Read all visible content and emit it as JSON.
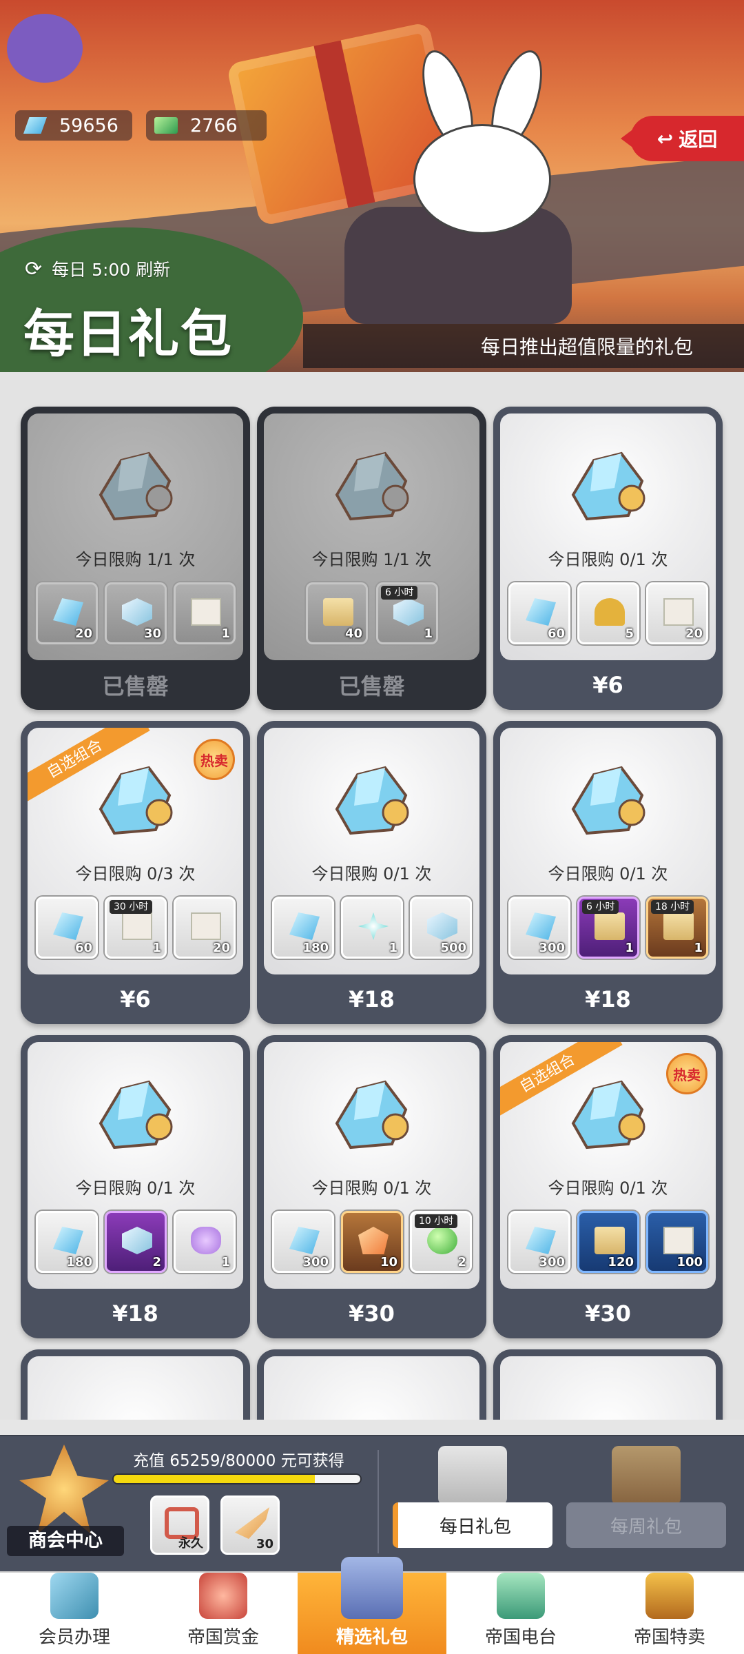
{
  "header": {
    "currencies": [
      {
        "icon": "gem-icon",
        "value": "59656"
      },
      {
        "icon": "cash-icon",
        "value": "2766"
      }
    ],
    "back_label": "返回",
    "refresh_text": "每日 5:00 刷新",
    "title": "每日礼包",
    "subtitle": "每日推出超值限量的礼包"
  },
  "cards": [
    {
      "limit": "今日限购 1/1 次",
      "price": "已售罄",
      "sold": true,
      "items": [
        {
          "count": "20",
          "icon": "gem"
        },
        {
          "count": "30",
          "icon": "cube"
        },
        {
          "count": "1",
          "icon": "blue-map"
        }
      ]
    },
    {
      "limit": "今日限购 1/1 次",
      "price": "已售罄",
      "sold": true,
      "items": [
        {
          "count": "40",
          "icon": "blue-scroll"
        },
        {
          "count": "1",
          "icon": "cube",
          "tag": "6 小时"
        }
      ]
    },
    {
      "limit": "今日限购 0/1 次",
      "price": "¥6",
      "sold": false,
      "items": [
        {
          "count": "60",
          "icon": "gem"
        },
        {
          "count": "5",
          "icon": "key"
        },
        {
          "count": "20",
          "icon": "paper"
        }
      ]
    },
    {
      "limit": "今日限购 0/3 次",
      "price": "¥6",
      "sold": false,
      "ribbon": "自选组合",
      "hot": "热卖",
      "items": [
        {
          "count": "60",
          "icon": "gem"
        },
        {
          "count": "1",
          "icon": "paper",
          "tag": "30 小时"
        },
        {
          "count": "20",
          "icon": "paper"
        }
      ]
    },
    {
      "limit": "今日限购 0/1 次",
      "price": "¥18",
      "sold": false,
      "items": [
        {
          "count": "180",
          "icon": "gem"
        },
        {
          "count": "1",
          "icon": "flower"
        },
        {
          "count": "500",
          "icon": "cube"
        }
      ]
    },
    {
      "limit": "今日限购 0/1 次",
      "price": "¥18",
      "sold": false,
      "items": [
        {
          "count": "300",
          "icon": "gem"
        },
        {
          "count": "1",
          "icon": "purple-book",
          "tag": "6 小时"
        },
        {
          "count": "1",
          "icon": "gold-book",
          "tag": "18 小时"
        }
      ]
    },
    {
      "limit": "今日限购 0/1 次",
      "price": "¥18",
      "sold": false,
      "items": [
        {
          "count": "180",
          "icon": "gem"
        },
        {
          "count": "2",
          "icon": "purple-box"
        },
        {
          "count": "1",
          "icon": "potion"
        }
      ]
    },
    {
      "limit": "今日限购 0/1 次",
      "price": "¥30",
      "sold": false,
      "items": [
        {
          "count": "300",
          "icon": "gem"
        },
        {
          "count": "10",
          "icon": "orange-gem"
        },
        {
          "count": "2",
          "icon": "orb",
          "tag": "10 小时"
        }
      ]
    },
    {
      "limit": "今日限购 0/1 次",
      "price": "¥30",
      "sold": false,
      "ribbon": "自选组合",
      "hot": "热卖",
      "items": [
        {
          "count": "300",
          "icon": "gem"
        },
        {
          "count": "120",
          "icon": "blue-scroll"
        },
        {
          "count": "100",
          "icon": "blue-map"
        }
      ]
    }
  ],
  "panel": {
    "label": "商会中心",
    "progress_text": "充值 65259/80000 元可获得",
    "progress_fraction": 0.816,
    "rewards": [
      {
        "icon": "frame-icon",
        "count": "永久"
      },
      {
        "icon": "wing-icon",
        "count": "30"
      }
    ],
    "daily_tab": "每日礼包",
    "weekly_tab": "每周礼包"
  },
  "nav": [
    {
      "label": "会员办理",
      "icon": "member-card-icon"
    },
    {
      "label": "帝国赏金",
      "icon": "bounty-icon"
    },
    {
      "label": "精选礼包",
      "icon": "gift-pack-icon",
      "active": true
    },
    {
      "label": "帝国电台",
      "icon": "radio-icon"
    },
    {
      "label": "帝国特卖",
      "icon": "treasure-chest-icon"
    }
  ],
  "colors": {
    "accent": "#f39a2e",
    "back_button": "#d7282d",
    "card_bg": "#4b5160",
    "progress_fill": "#f5d90e"
  }
}
